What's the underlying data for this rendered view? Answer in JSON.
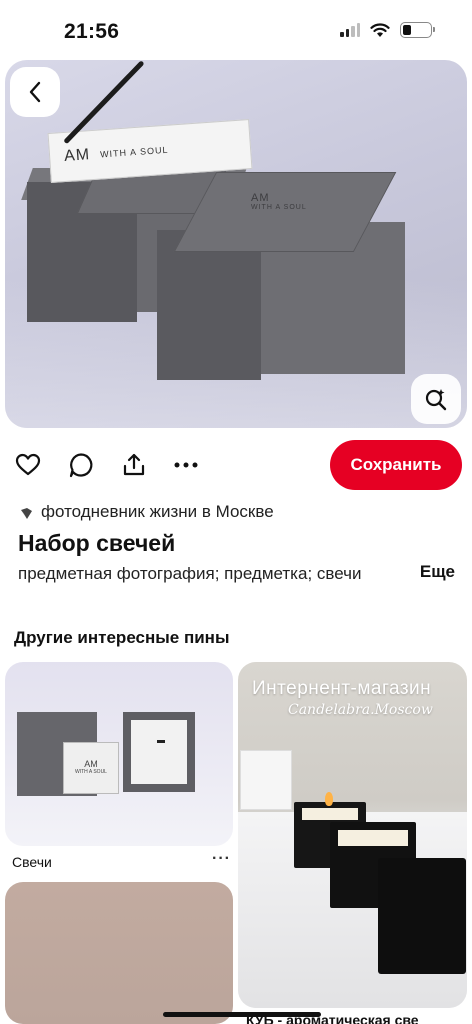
{
  "status_bar": {
    "time": "21:56",
    "battery_level": 0.3
  },
  "pin": {
    "author": "фотодневник жизни в Москве",
    "title": "Набор свечей",
    "description": "предметная фотография; предметка; свечи",
    "more_label": "Еще",
    "image_labels": {
      "box_brand": "AM",
      "box_tagline": "WITH A SOUL",
      "lid_brand": "AM",
      "lid_tagline": "WITH A SOUL"
    }
  },
  "actions": {
    "save_label": "Сохранить"
  },
  "related": {
    "section_title": "Другие интересные пины",
    "cards": [
      {
        "caption": "Свечи",
        "more": "···",
        "image_labels": {
          "brand": "AM",
          "tagline": "WITH A SOUL"
        }
      },
      {
        "caption": "КУБ - ароматическая све",
        "headline": "Интернент-магазин",
        "script": "Candelabra.Moscow"
      },
      {
        "caption": ""
      }
    ]
  },
  "colors": {
    "accent": "#e60023",
    "text": "#111111"
  },
  "icons": [
    "chevron-left-icon",
    "visual-search-icon",
    "heart-icon",
    "comment-icon",
    "share-icon",
    "more-dots-icon",
    "signal-icon",
    "wifi-icon",
    "battery-icon"
  ]
}
